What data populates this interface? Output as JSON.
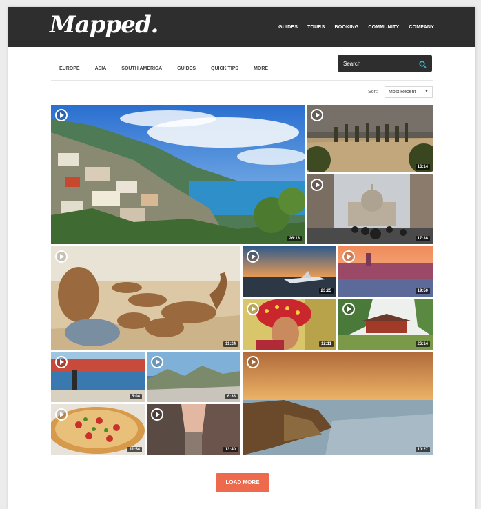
{
  "brand": {
    "logo": "Mapped."
  },
  "topnav": [
    "GUIDES",
    "TOURS",
    "BOOKING",
    "COMMUNITY",
    "COMPANY"
  ],
  "subnav": [
    "EUROPE",
    "ASIA",
    "SOUTH AMERICA",
    "GUIDES",
    "QUICK TIPS",
    "MORE"
  ],
  "search": {
    "placeholder": "Search"
  },
  "sort": {
    "label": "Sort:",
    "value": "Most Recent"
  },
  "videos": [
    {
      "duration": "26:13"
    },
    {
      "duration": "16:14"
    },
    {
      "duration": "17:38"
    },
    {
      "duration": "11:24"
    },
    {
      "duration": "23:25"
    },
    {
      "duration": "19:50"
    },
    {
      "duration": "12:11"
    },
    {
      "duration": "26:14"
    },
    {
      "duration": "5:04"
    },
    {
      "duration": "6:33"
    },
    {
      "duration": "10:27"
    },
    {
      "duration": "11:54"
    },
    {
      "duration": "13:40"
    }
  ],
  "load_more": "LOAD MORE"
}
